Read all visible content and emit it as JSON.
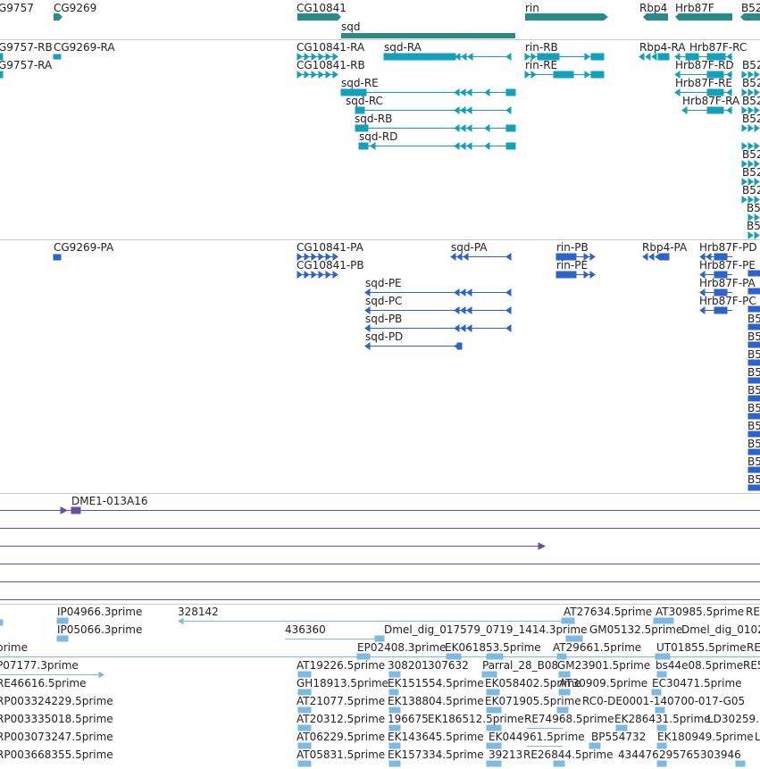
{
  "colors": {
    "gene": "#2b8a8a",
    "transcript": "#13a0b8",
    "cds": "#2e64c8",
    "clone": "#6a4fa0",
    "est": "#7db9e0",
    "separator": "#c8c8c8",
    "text": "#222222"
  },
  "tracks": {
    "genes": {
      "labels": [
        "G9757",
        "CG9269",
        "CG10841",
        "sqd",
        "rin",
        "Rbp4",
        "Hrb87F",
        "B52"
      ]
    },
    "transcripts": {
      "labels": [
        "G9757-RB",
        "CG9269-RA",
        "CG10841-RA",
        "sqd-RA",
        "rin-RB",
        "Rbp4-RA",
        "Hrb87F-RC",
        "G9757-RA",
        "CG10841-RB",
        "rin-RE",
        "Hrb87F-RD",
        "sqd-RE",
        "Hrb87F-RE",
        "sqd-RC",
        "Hrb87F-RA",
        "sqd-RB",
        "sqd-RD"
      ],
      "b52_stack_labels": [
        "B52",
        "B52",
        "B52",
        "B52",
        "B52",
        "B52",
        "B52",
        "B5",
        "B5"
      ]
    },
    "cds": {
      "labels": [
        "CG9269-PA",
        "CG10841-PA",
        "sqd-PA",
        "rin-PB",
        "Rbp4-PA",
        "Hrb87F-PD",
        "CG10841-PB",
        "rin-PE",
        "Hrb87F-PE",
        "sqd-PE",
        "Hrb87F-PA",
        "sqd-PC",
        "Hrb87F-PC",
        "sqd-PB",
        "sqd-PD"
      ],
      "b5_stack_labels": [
        "B5",
        "B5",
        "B5",
        "B5",
        "B5",
        "B5",
        "B5",
        "B5",
        "B5",
        "B5"
      ]
    },
    "clones": {
      "labels": [
        "DME1-013A16"
      ]
    },
    "ests": {
      "rows": [
        [
          "IP04966.3prime",
          "328142",
          "AT27634.5prime",
          "AT30985.5prime",
          "RE"
        ],
        [
          "IP05066.3prime",
          "436360",
          "Dmel_dig_017579_0719_1414.3prime",
          "GM05132.5prime",
          "Dmel_dig_0102"
        ],
        [
          "prime",
          "EP02408.3prime",
          "EK061853.5prime",
          "AT29661.5prime",
          "UT01855.5prime",
          "RE"
        ],
        [
          "P07177.3prime",
          "AT19226.5prime",
          "308201",
          "307632",
          "Parral_28_B08",
          "GM23901.5prime",
          "bs44e08.5prime",
          "RE5"
        ],
        [
          "RE46616.5prime",
          "GH18913.5prime",
          "EK151554.5prime",
          "EK058402.5prime",
          "AT30909.5prime",
          "EC30471.5prime"
        ],
        [
          "RP003324229.5prime",
          "AT21077.5prime",
          "EK138804.5prime",
          "EK071905.5prime",
          "RC0-DE0001-140700-017-G05"
        ],
        [
          "RP003335018.5prime",
          "AT20312.5prime",
          "196675",
          "EK186512.5prime",
          "RE74968.5prime",
          "EK286431.5prime",
          "LD30259."
        ],
        [
          "RP003073247.5prime",
          "AT06229.5prime",
          "EK143645.5prime",
          "EK044961.5prime",
          "BP554732",
          "EK180949.5prime",
          "L"
        ],
        [
          "RP003668355.5prime",
          "AT05831.5prime",
          "EK157334.5prime",
          "39213",
          "RE26844.5prime",
          "434476",
          "295765",
          "303946"
        ]
      ]
    }
  }
}
